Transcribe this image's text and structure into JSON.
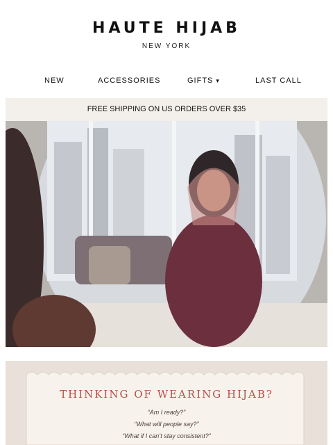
{
  "brand": {
    "name": "HAUTE HIJAB",
    "location": "NEW YORK"
  },
  "nav": [
    {
      "label": "NEW"
    },
    {
      "label": "ACCESSORIES"
    },
    {
      "label": "GIFTS"
    },
    {
      "label": "LAST CALL"
    }
  ],
  "shipping_banner": "FREE SHIPPING ON US ORDERS OVER $35",
  "hero": {
    "image": "woman-in-hijab-smiling-in-mirror"
  },
  "promo": {
    "title": "THINKING OF WEARING HIJAB?",
    "quotes": [
      "“Am I ready?”",
      "“What will people say?”",
      "“What if I can’t stay consistent?”"
    ]
  },
  "colors": {
    "accent": "#b44f45",
    "banner_bg": "#f3efea",
    "promo_bg": "#e9e0d9"
  }
}
